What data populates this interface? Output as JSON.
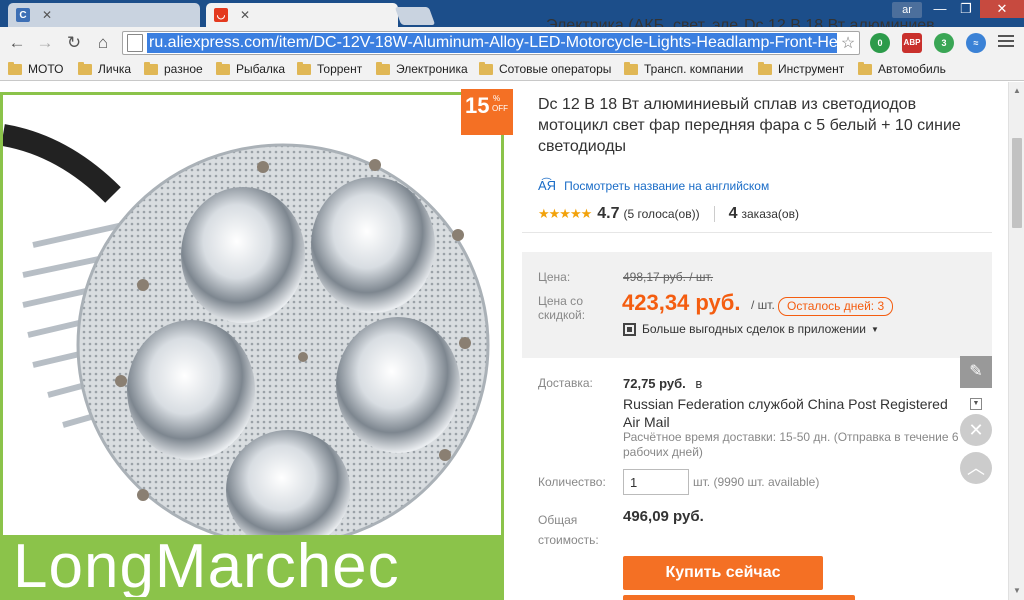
{
  "browser": {
    "tabs": [
      {
        "title": "Электрика (АКБ, свет, эле",
        "favicon": "C",
        "active": false
      },
      {
        "title": "Dc 12 В 18 Вт алюминиев",
        "favicon": "aliexpress-icon",
        "active": true
      }
    ],
    "user_label": "ar",
    "window_controls": {
      "minimize": "—",
      "maximize": "❐",
      "close": "✕"
    },
    "url": "ru.aliexpress.com/item/DC-12V-18W-Aluminum-Alloy-LED-Motorcycle-Lights-Headlamp-Front-He",
    "extensions": [
      {
        "name": "extension-icon",
        "badge": "0"
      },
      {
        "name": "adblock-icon",
        "label": "ABP",
        "badge": "5"
      },
      {
        "name": "extension-green-icon",
        "badge": "3"
      },
      {
        "name": "extension-blue-icon"
      }
    ],
    "bookmarks": [
      "МОТО",
      "Личка",
      "разное",
      "Рыбалка",
      "Торрент",
      "Электроника",
      "Сотовые операторы",
      "Трансп. компании",
      "Инструмент",
      "Автомобиль"
    ]
  },
  "product": {
    "discount": {
      "percent": "15",
      "pct_sign": "%",
      "off": "OFF"
    },
    "brand_text": "LongMarchec",
    "title": "Dc 12 В 18 Вт алюминиевый сплав из светодиодов мотоцикл свет фар передняя фара с 5 белый + 10 синие светодиоды",
    "translate_link": "Посмотреть название на английском",
    "rating": {
      "score": "4.7",
      "votes": "(5 голоса(ов))",
      "orders_count": "4",
      "orders_label": "заказа(ов)",
      "stars_filled": 4.7
    },
    "price": {
      "label": "Цена:",
      "old": "498,17 руб. / шт.",
      "discount_label": "Цена со скидкой:",
      "new": "423,34 руб.",
      "unit": "/ шт.",
      "days_left": "Осталось дней: 3",
      "app_deals": "Больше выгодных сделок в приложении"
    },
    "shipping": {
      "label": "Доставка:",
      "price": "72,75 руб.",
      "preposition": "в",
      "method": "Russian Federation службой China Post Registered Air Mail",
      "estimate": "Расчётное время доставки: 15-50 дн. (Отправка в течение 6 рабочих дней)"
    },
    "quantity": {
      "label": "Количество:",
      "value": "1",
      "available": "шт. (9990 шт. available)"
    },
    "total": {
      "label": "Общая стоимость:",
      "value": "496,09 руб."
    },
    "buy_button": "Купить сейчас"
  },
  "colors": {
    "accent_orange": "#f47024",
    "price_orange": "#f45d10",
    "brand_green": "#8bc34a",
    "link_blue": "#1a6cc7"
  }
}
